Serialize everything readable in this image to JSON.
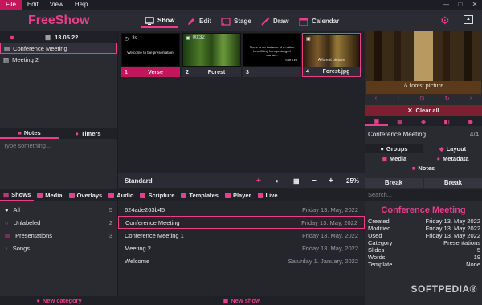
{
  "menu": [
    "File",
    "Edit",
    "View",
    "Help"
  ],
  "window": {
    "min": "—",
    "max": "□",
    "close": "✕"
  },
  "app": {
    "title": "FreeShow"
  },
  "tabs": {
    "show": "Show",
    "edit": "Edit",
    "stage": "Stage",
    "draw": "Draw",
    "calendar": "Calendar"
  },
  "projects": {
    "date": "13.05.22",
    "items": [
      "Conference Meeting",
      "Meeting 2"
    ]
  },
  "notes": {
    "tab1": "Notes",
    "tab2": "Timers",
    "placeholder": "Type something..."
  },
  "slides": [
    {
      "num": "1",
      "label": "Verse",
      "text": "Welcome to the presentation!",
      "timer": "3s"
    },
    {
      "num": "2",
      "label": "Forest",
      "timer": "00:32"
    },
    {
      "num": "3",
      "label": "",
      "text": "There is no instance of a nation benefitting from prolonged warfare.",
      "author": "- Sun Tzu"
    },
    {
      "num": "4",
      "label": "Forest.jpg"
    }
  ],
  "stagebar": {
    "label": "Standard",
    "add": "+",
    "zoom": "25%",
    "minus": "−",
    "plus": "+"
  },
  "preview": {
    "caption": "A forest picture",
    "clear": "Clear all"
  },
  "right": {
    "show_name": "Conference Meeting",
    "count": "4/4",
    "groups": "Groups",
    "layout": "Layout",
    "media": "Media",
    "metadata": "Metadata",
    "notes": "Notes",
    "break1": "Break",
    "break2": "Break"
  },
  "bottomtabs": [
    "Shows",
    "Media",
    "Overlays",
    "Audio",
    "Scripture",
    "Templates",
    "Player",
    "Live"
  ],
  "categories": [
    {
      "label": "All",
      "count": "5"
    },
    {
      "label": "Unlabeled",
      "count": "2"
    },
    {
      "label": "Presentations",
      "count": "3"
    },
    {
      "label": "Songs",
      "count": ""
    }
  ],
  "shows": [
    {
      "name": "624ade263b45",
      "date": "Friday 13. May, 2022"
    },
    {
      "name": "Conference Meeting",
      "date": "Friday 13. May, 2022"
    },
    {
      "name": "Conference Meeting 1",
      "date": "Friday 13. May, 2022"
    },
    {
      "name": "Meeting 2",
      "date": "Friday 13. May, 2022"
    },
    {
      "name": "Welcome",
      "date": "Saturday 1. January, 2022"
    }
  ],
  "footer": {
    "new_category": "New category",
    "new_show": "New show"
  },
  "search": {
    "placeholder": "Search..."
  },
  "info": {
    "title": "Conference Meeting",
    "rows": [
      {
        "k": "Created",
        "v": "Friday 13. May 2022"
      },
      {
        "k": "Modified",
        "v": "Friday 13. May 2022"
      },
      {
        "k": "Used",
        "v": "Friday 13. May 2022"
      },
      {
        "k": "Category",
        "v": "Presentations"
      },
      {
        "k": "Slides",
        "v": "5"
      },
      {
        "k": "Words",
        "v": "19"
      },
      {
        "k": "Template",
        "v": "None"
      }
    ]
  },
  "watermark": "SOFTPEDIA®"
}
